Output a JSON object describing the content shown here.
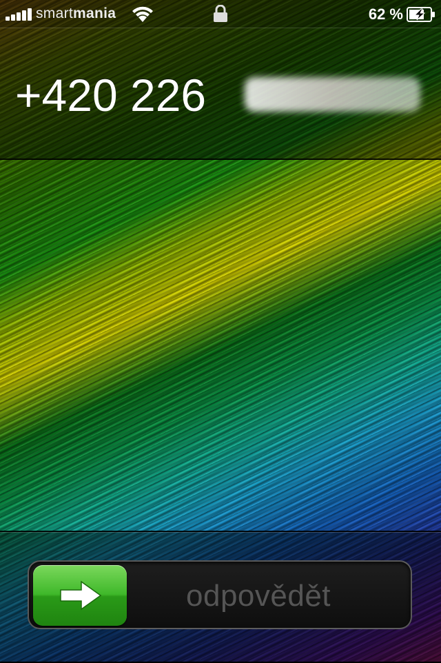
{
  "status_bar": {
    "carrier_prefix": "smart",
    "carrier_suffix": "mania",
    "battery_percent": "62 %",
    "signal_bars": 5,
    "battery_state": "charging"
  },
  "incoming_call": {
    "caller_number": "+420 226",
    "caller_number_redacted": true
  },
  "answer_slider": {
    "label": "odpovědět",
    "knob_icon": "arrow-right-icon",
    "accent_color": "#3fb82a"
  }
}
